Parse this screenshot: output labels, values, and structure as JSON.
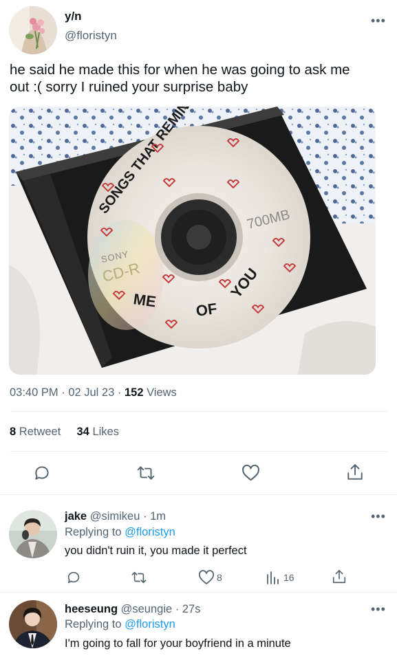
{
  "tweet": {
    "author_name": "y/n",
    "author_handle": "@floristyn",
    "text_line1": "he said he made this for when he was going to ask me",
    "text_line2": "out :( sorry I ruined your surprise baby",
    "time": "03:40 PM",
    "date": "02 Jul 23",
    "views_count": "152",
    "views_label": "Views",
    "retweets_count": "8",
    "retweets_label": "Retweet",
    "likes_count": "34",
    "likes_label": "Likes",
    "image_alt_text": {
      "arc_top": "SONGS THAT REMIND",
      "arc_bottom_me": "ME",
      "arc_bottom_of": "OF",
      "arc_bottom_you": "YOU",
      "brand": "SONY",
      "cd_type": "CD-R",
      "capacity": "700MB"
    }
  },
  "replies": [
    {
      "name": "jake",
      "handle": "@simikeu",
      "time": "1m",
      "replying_prefix": "Replying to",
      "replying_to": "@floristyn",
      "text": "you didn't ruin it, you made it perfect",
      "likes": "8",
      "views": "16"
    },
    {
      "name": "heeseung",
      "handle": "@seungie",
      "time": "27s",
      "replying_prefix": "Replying to",
      "replying_to": "@floristyn",
      "text": "I'm going to fall for your boyfriend in a minute"
    }
  ],
  "icons": {
    "reply": "reply-icon",
    "retweet": "retweet-icon",
    "like": "heart-icon",
    "share": "share-icon",
    "views": "views-chart-icon",
    "more": "more-dots-icon"
  },
  "colors": {
    "text": "#0f1419",
    "muted": "#536471",
    "link": "#1d9bf0",
    "divider": "#eff3f4"
  }
}
